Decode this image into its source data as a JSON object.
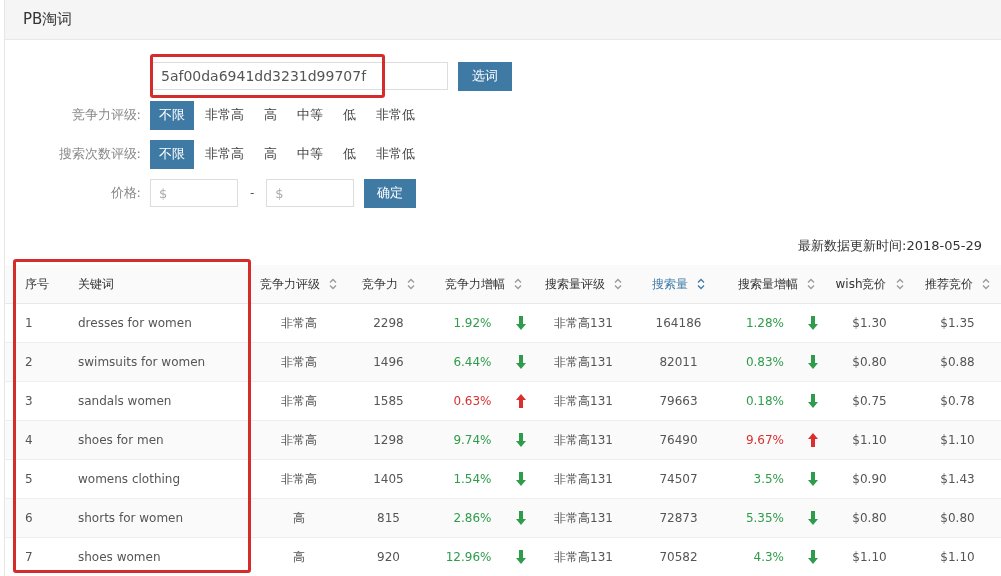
{
  "page": {
    "title": "PB淘词"
  },
  "search": {
    "value": "5af00da6941dd3231d99707f",
    "button": "选词"
  },
  "filters": [
    {
      "label": "竞争力评级:",
      "options": [
        {
          "label": "不限",
          "selected": true
        },
        {
          "label": "非常高",
          "selected": false
        },
        {
          "label": "高",
          "selected": false
        },
        {
          "label": "中等",
          "selected": false
        },
        {
          "label": "低",
          "selected": false
        },
        {
          "label": "非常低",
          "selected": false
        }
      ]
    },
    {
      "label": "搜索次数评级:",
      "options": [
        {
          "label": "不限",
          "selected": true
        },
        {
          "label": "非常高",
          "selected": false
        },
        {
          "label": "高",
          "selected": false
        },
        {
          "label": "中等",
          "selected": false
        },
        {
          "label": "低",
          "selected": false
        },
        {
          "label": "非常低",
          "selected": false
        }
      ]
    }
  ],
  "price": {
    "label": "价格:",
    "min_placeholder": "$",
    "separator": "-",
    "max_placeholder": "$",
    "button": "确定"
  },
  "updated": "最新数据更新时间:2018-05-29",
  "table": {
    "columns": [
      {
        "label": "序号",
        "sortable": false,
        "sorted": false
      },
      {
        "label": "关键词",
        "sortable": false,
        "sorted": false
      },
      {
        "label": "竞争力评级",
        "sortable": true,
        "sorted": false
      },
      {
        "label": "竞争力",
        "sortable": true,
        "sorted": false
      },
      {
        "label": "竞争力增幅",
        "sortable": true,
        "sorted": false
      },
      {
        "label": "搜索量评级",
        "sortable": true,
        "sorted": false
      },
      {
        "label": "搜索量",
        "sortable": true,
        "sorted": true
      },
      {
        "label": "搜索量增幅",
        "sortable": true,
        "sorted": false
      },
      {
        "label": "wish竞价",
        "sortable": true,
        "sorted": false
      },
      {
        "label": "推荐竞价",
        "sortable": true,
        "sorted": false
      }
    ],
    "rows": [
      {
        "index": "1",
        "keyword": "dresses for women",
        "competition_rating": "非常高",
        "competition": "2298",
        "competition_change": "1.92%",
        "competition_rising": false,
        "search_rating": "非常高131",
        "search_volume": "164186",
        "search_change": "1.28%",
        "search_rising": false,
        "wish_bid": "$1.30",
        "suggested_bid": "$1.35"
      },
      {
        "index": "2",
        "keyword": "swimsuits for women",
        "competition_rating": "非常高",
        "competition": "1496",
        "competition_change": "6.44%",
        "competition_rising": false,
        "search_rating": "非常高131",
        "search_volume": "82011",
        "search_change": "0.83%",
        "search_rising": false,
        "wish_bid": "$0.80",
        "suggested_bid": "$0.88"
      },
      {
        "index": "3",
        "keyword": "sandals women",
        "competition_rating": "非常高",
        "competition": "1585",
        "competition_change": "0.63%",
        "competition_rising": true,
        "search_rating": "非常高131",
        "search_volume": "79663",
        "search_change": "0.18%",
        "search_rising": false,
        "wish_bid": "$0.75",
        "suggested_bid": "$0.78"
      },
      {
        "index": "4",
        "keyword": "shoes for men",
        "competition_rating": "非常高",
        "competition": "1298",
        "competition_change": "9.74%",
        "competition_rising": false,
        "search_rating": "非常高131",
        "search_volume": "76490",
        "search_change": "9.67%",
        "search_rising": true,
        "wish_bid": "$1.10",
        "suggested_bid": "$1.10"
      },
      {
        "index": "5",
        "keyword": "womens clothing",
        "competition_rating": "非常高",
        "competition": "1405",
        "competition_change": "1.54%",
        "competition_rising": false,
        "search_rating": "非常高131",
        "search_volume": "74507",
        "search_change": "3.5%",
        "search_rising": false,
        "wish_bid": "$0.90",
        "suggested_bid": "$1.43"
      },
      {
        "index": "6",
        "keyword": "shorts for women",
        "competition_rating": "高",
        "competition": "815",
        "competition_change": "2.86%",
        "competition_rising": false,
        "search_rating": "非常高131",
        "search_volume": "72873",
        "search_change": "5.35%",
        "search_rising": false,
        "wish_bid": "$0.80",
        "suggested_bid": "$0.80"
      },
      {
        "index": "7",
        "keyword": "shoes women",
        "competition_rating": "高",
        "competition": "920",
        "competition_change": "12.96%",
        "competition_rising": false,
        "search_rating": "非常高131",
        "search_volume": "70582",
        "search_change": "4.3%",
        "search_rising": false,
        "wish_bid": "$1.10",
        "suggested_bid": "$1.10"
      }
    ]
  }
}
